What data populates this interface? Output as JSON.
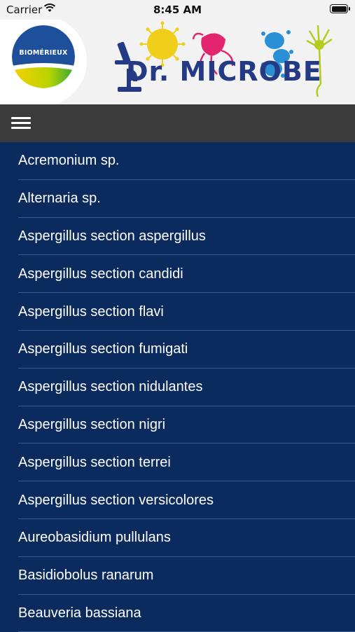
{
  "status_bar": {
    "carrier": "Carrier",
    "time": "8:45 AM"
  },
  "header": {
    "brand": "BIOMÉRIEUX",
    "app_title": "Dr. MICROBE"
  },
  "colors": {
    "list_background": "#0b2a5e",
    "toolbar": "#3b3b3b",
    "title_blue": "#243a84"
  },
  "list": {
    "items": [
      "Acremonium sp.",
      "Alternaria sp.",
      "Aspergillus section aspergillus",
      "Aspergillus section candidi",
      "Aspergillus section flavi",
      "Aspergillus section fumigati",
      "Aspergillus section nidulantes",
      "Aspergillus section nigri",
      "Aspergillus section terrei",
      "Aspergillus section versicolores",
      "Aureobasidium pullulans",
      "Basidiobolus ranarum",
      "Beauveria bassiana"
    ]
  }
}
